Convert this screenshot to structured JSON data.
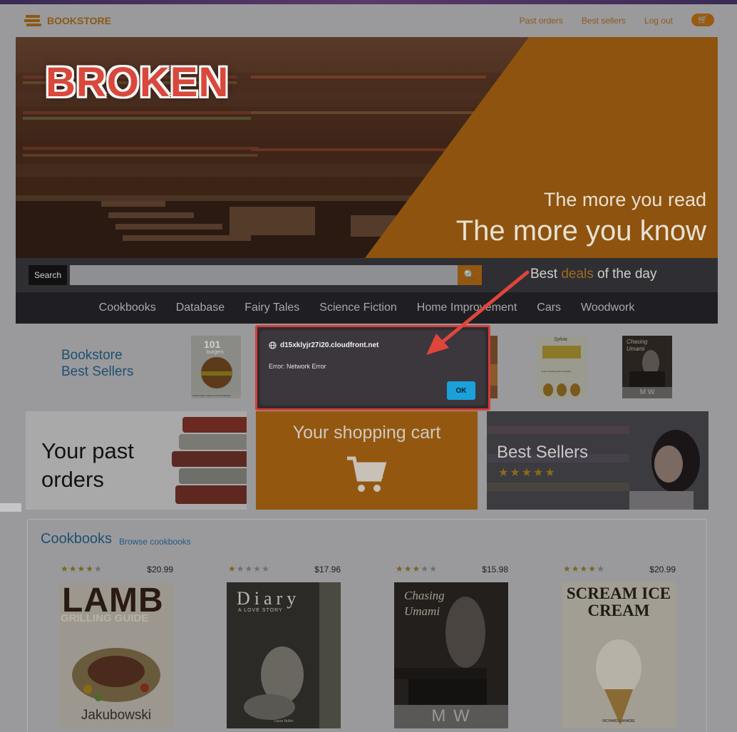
{
  "app": {
    "logo_text": "BOOKSTORE",
    "nav_links": [
      "Past orders",
      "Best sellers",
      "Log out"
    ],
    "cart_icon": "cart-icon"
  },
  "hero": {
    "stamp": "BROKEN",
    "line1": "The more you read",
    "line2": "The more you know"
  },
  "search": {
    "label": "Search",
    "placeholder": "",
    "button_icon": "search-icon",
    "deals_prefix": "Best ",
    "deals_highlight": "deals",
    "deals_suffix": " of the day"
  },
  "categories": [
    "Cookbooks",
    "Database",
    "Fairy Tales",
    "Science Fiction",
    "Home Improvement",
    "Cars",
    "Woodwork"
  ],
  "best_sellers": {
    "title_line1": "Bookstore",
    "title_line2": "Best Sellers",
    "books": [
      {
        "title": "101",
        "subtitle": "burgers",
        "caption": "EVERYONE LOVES A GOOD BURGER"
      },
      {
        "title": "Sylvia",
        "subtitle": "",
        "caption": "Cook everything with pineapple"
      },
      {
        "title": "Chasing Umami",
        "subtitle": "",
        "caption": "M W"
      }
    ]
  },
  "tiles": {
    "past_orders_line1": "Your past",
    "past_orders_line2": "orders",
    "cart": "Your shopping cart",
    "best_sellers": "Best Sellers",
    "best_sellers_stars": "★★★★★"
  },
  "cookbooks": {
    "title": "Cookbooks",
    "link": "Browse cookbooks",
    "products": [
      {
        "rating": 4,
        "price": "$20.99",
        "cover_title": "LAMB",
        "cover_sub": "GRILLING GUIDE",
        "author": "Jakubowski"
      },
      {
        "rating": 1,
        "price": "$17.96",
        "cover_title": "Diary",
        "cover_sub": "A LOVE STORY",
        "author": "Laura Noller"
      },
      {
        "rating": 3,
        "price": "$15.98",
        "cover_title": "Chasing Umami",
        "cover_sub": "",
        "author": "M W"
      },
      {
        "rating": 4,
        "price": "$20.99",
        "cover_title": "SCREAM ICE CREAM",
        "cover_sub": "",
        "author": "RICHARD LAHADIE"
      }
    ]
  },
  "dialog": {
    "origin": "d15xklyjr27i20.cloudfront.net",
    "message": "Error: Network Error",
    "ok": "OK"
  },
  "colors": {
    "accent": "#93570f",
    "annotation": "#e0453c",
    "dialog_button": "#1aa1d9"
  }
}
